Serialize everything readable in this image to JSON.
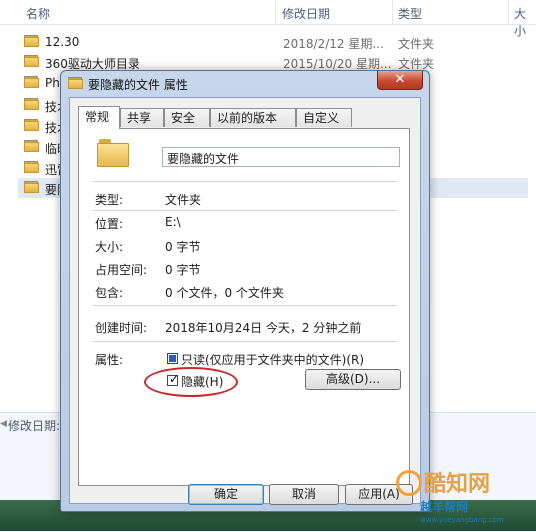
{
  "explorer": {
    "columns": {
      "name": "名称",
      "date": "修改日期",
      "type": "类型",
      "size": "大小"
    },
    "files": [
      {
        "name": "12.30",
        "date": "2018/2/12 星期...",
        "type": "文件夹"
      },
      {
        "name": "360驱动大师目录",
        "date": "2015/10/20 星期...",
        "type": "文件夹"
      },
      {
        "name": "Pho",
        "date": "",
        "type": ""
      },
      {
        "name": "技术",
        "date": "",
        "type": ""
      },
      {
        "name": "技术",
        "date": "",
        "type": ""
      },
      {
        "name": "临时",
        "date": "",
        "type": ""
      },
      {
        "name": "迅雷",
        "date": "",
        "type": ""
      },
      {
        "name": "要隐",
        "date": "",
        "type": ""
      }
    ],
    "details_label": "修改日期:"
  },
  "dialog": {
    "title": "要隐藏的文件 属性",
    "close_label": "✕",
    "tabs": [
      "常规",
      "共享",
      "安全",
      "以前的版本",
      "自定义"
    ],
    "folder_name": "要隐藏的文件",
    "props": [
      {
        "label": "类型:",
        "value": "文件夹"
      },
      {
        "label": "位置:",
        "value": "E:\\"
      },
      {
        "label": "大小:",
        "value": "0 字节"
      },
      {
        "label": "占用空间:",
        "value": "0 字节"
      },
      {
        "label": "包含:",
        "value": "0 个文件，0 个文件夹"
      }
    ],
    "created": {
      "label": "创建时间:",
      "value": "2018年10月24日 今天，2 分钟之前"
    },
    "attributes": {
      "label": "属性:",
      "readonly_label": "只读(仅应用于文件夹中的文件)(R)",
      "hidden_label": "隐藏(H)",
      "advanced_label": "高级(D)..."
    },
    "buttons": {
      "ok": "确定",
      "cancel": "取消",
      "apply": "应用(A)"
    }
  },
  "watermark": {
    "title": "酷知网",
    "sub": "越羊帮网",
    "url": "www.yueyangbang.com"
  },
  "colors": {
    "accent": "#2c5cb8",
    "highlight_ellipse": "#c8282a",
    "close_button": "#c84a31"
  }
}
